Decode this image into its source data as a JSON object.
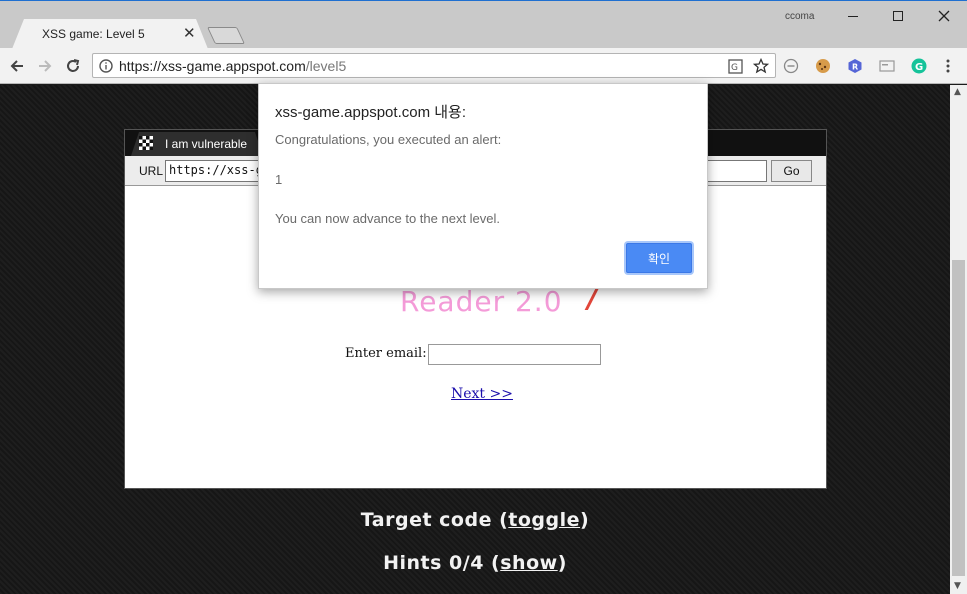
{
  "browser": {
    "tab_title": "XSS game: Level 5",
    "profile_name": "ccoma",
    "url_host": "https://xss-game.appspot.com",
    "url_path": "/level5"
  },
  "frame": {
    "tab_label": "I am vulnerable",
    "url_label": "URL",
    "url_value": "https://xss-game.appspot.com/level5/frame/signup?next=javascript:alert(1)",
    "go_label": "Go",
    "reader_title": "Reader 2.0",
    "email_label": "Enter email:",
    "email_value": "",
    "next_link": "Next >>"
  },
  "footer": {
    "target_prefix": "Target code (",
    "target_link": "toggle",
    "target_suffix": ")",
    "hints_prefix": "Hints 0/4 (",
    "hints_link": "show",
    "hints_suffix": ")"
  },
  "dialog": {
    "title": "xss-game.appspot.com 내용:",
    "line1": "Congratulations, you executed an alert:",
    "line2": "1",
    "line3": "You can now advance to the next level.",
    "ok_label": "확인"
  },
  "colors": {
    "accent": "#4a8af4",
    "reader_pink": "#f49bd8",
    "reader_red": "#e2463a"
  }
}
